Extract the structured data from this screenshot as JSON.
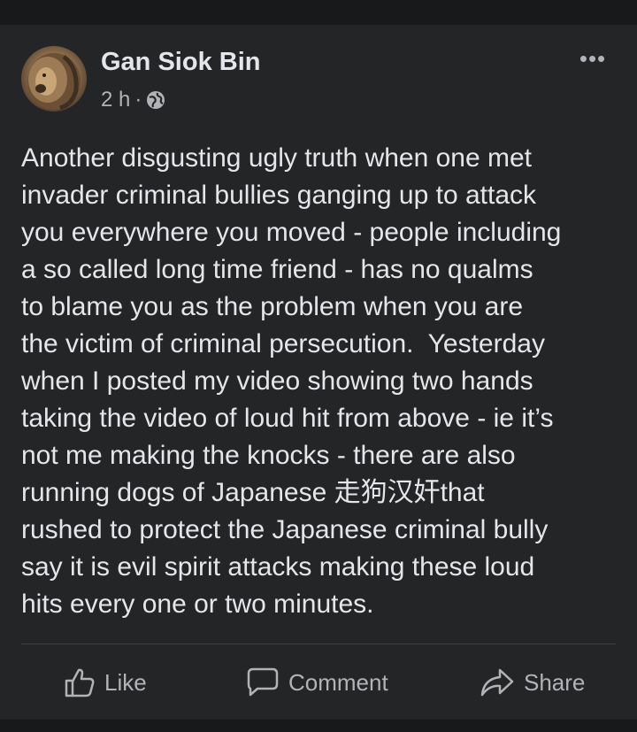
{
  "post": {
    "author": "Gan Siok Bin",
    "time": "2 h",
    "separator": "·",
    "more_label": "•••",
    "text": "Another disgusting ugly truth when one met\ninvader criminal bullies ganging up to attack\nyou everywhere you moved - people including\na so called long time friend - has no qualms\nto blame you as the problem when you are\nthe victim of criminal persecution.  Yesterday\nwhen I posted my video showing two hands\ntaking the video of loud hit from above - ie it’s\nnot me making the knocks - there are also\nrunning dogs of Japanese 走狗汉奸that\nrushed to protect the Japanese criminal bully\nsay it is evil spirit attacks making these loud\nhits every one or two minutes."
  },
  "actions": {
    "like_label": "Like",
    "comment_label": "Comment",
    "share_label": "Share"
  },
  "icons": {
    "avatar": "lion-avatar",
    "privacy": "globe-icon",
    "more": "more-options-icon",
    "like": "thumbs-up-icon",
    "comment": "speech-bubble-icon",
    "share": "share-arrow-icon"
  },
  "colors": {
    "page_background": "#18191a",
    "card_background": "#242526",
    "primary_text": "#e4e6eb",
    "secondary_text": "#b0b3b8",
    "divider": "#3e4042"
  }
}
